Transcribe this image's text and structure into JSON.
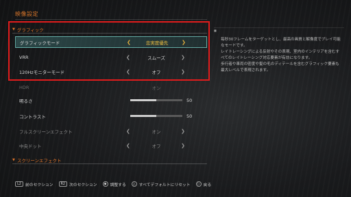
{
  "header": {
    "title": "映像設定"
  },
  "sections": {
    "graphics": "グラフィック",
    "screen_effect": "スクリーンエフェクト"
  },
  "rows": [
    {
      "label": "グラフィックモード",
      "value": "忠実度優先",
      "state": "selected"
    },
    {
      "label": "VRR",
      "value": "スムーズ",
      "state": "normal"
    },
    {
      "label": "120Hzモニターモード",
      "value": "オフ",
      "state": "normal"
    },
    {
      "label": "HDR",
      "value": "オン",
      "state": "disabled"
    },
    {
      "label": "明るさ",
      "value": 50,
      "slider": 0.5,
      "state": "normal"
    },
    {
      "label": "コントラスト",
      "value": 50,
      "slider": 0.5,
      "state": "normal"
    },
    {
      "label": "フルスクリーンエフェクト",
      "value": "オン",
      "state": "dim"
    },
    {
      "label": "中央ドット",
      "value": "オフ",
      "state": "dim"
    }
  ],
  "description": "毎秒30フレームをターゲットとし、最高の画質と解像度でプレイ可能なモードです。\nレイトレーシングによる反射やその表現、室内のインテリアを含むすべてのレイトレーシング対応要素が有効になります。\n歩行者や車両の密度や髪の毛のディテールを含むグラフィック要素も最大レベルで表現されます。",
  "footer": [
    {
      "button": "L2",
      "label": "前のセクション"
    },
    {
      "button": "R2",
      "label": "次のセクション"
    },
    {
      "button": "◆",
      "label": "調整する"
    },
    {
      "button": "△",
      "label": "すべてデフォルトにリセット"
    },
    {
      "button": "○",
      "label": "戻る"
    }
  ],
  "colors": {
    "accent": "#e0752a",
    "highlight": "#f2c040",
    "selection_border": "#78d2c8",
    "annotation_box": "#e21c1c"
  },
  "icons": {
    "prev": "arrow-left-icon",
    "next": "arrow-right-icon"
  }
}
